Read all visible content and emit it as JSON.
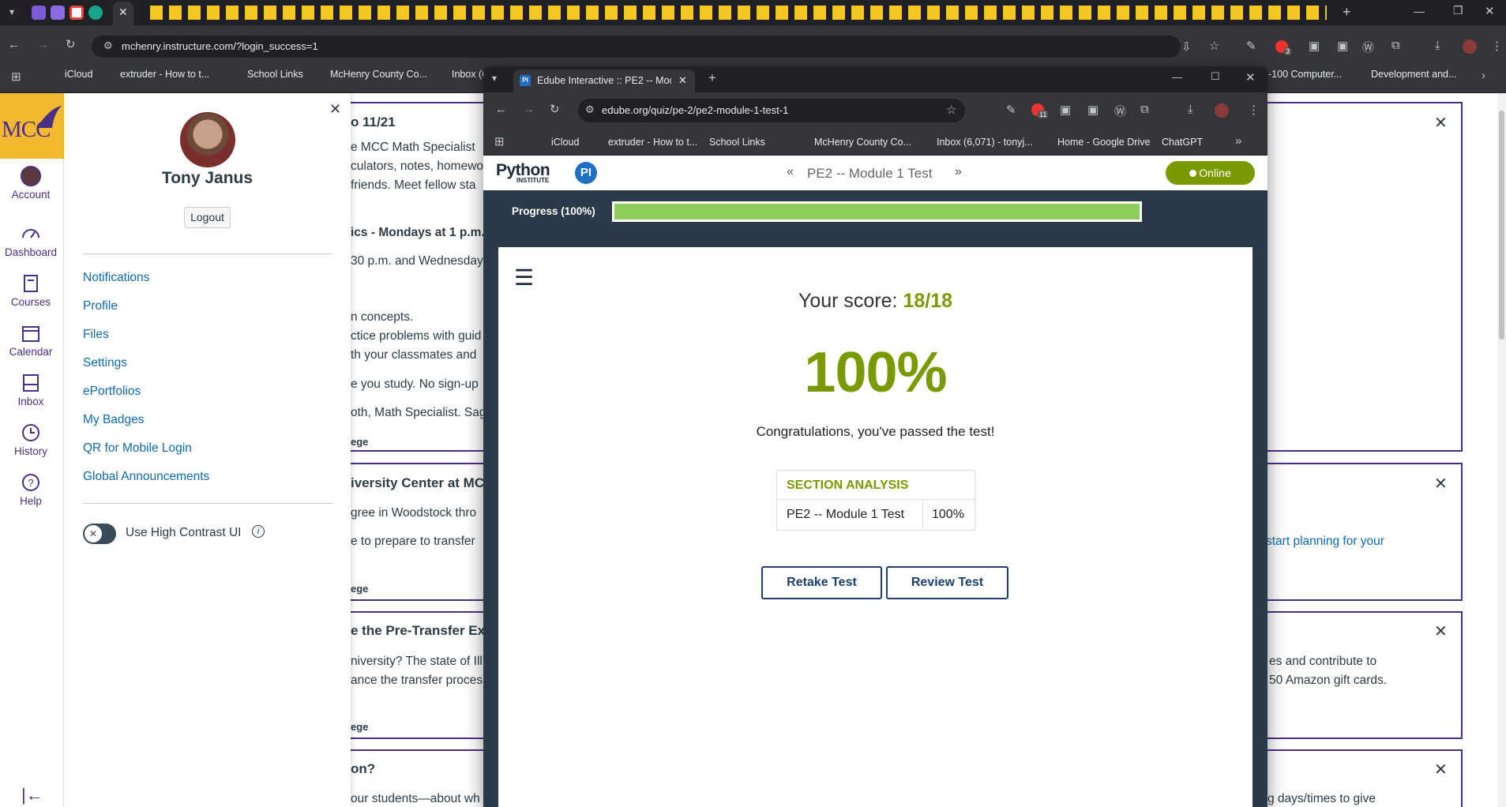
{
  "outer_browser": {
    "url": "mchenry.instructure.com/?login_success=1",
    "bookmarks": [
      "iCloud",
      "extruder - How to t...",
      "School Links",
      "McHenry County Co...",
      "Inbox (6,071) - tonyj...",
      "-100 Computer...",
      "Development and..."
    ],
    "extension_badge": "3"
  },
  "canvas": {
    "global_nav": {
      "logo": "MCC",
      "items": [
        "Account",
        "Dashboard",
        "Courses",
        "Calendar",
        "Inbox",
        "History",
        "Help"
      ]
    },
    "account_tray": {
      "user_name": "Tony Janus",
      "logout_label": "Logout",
      "links": [
        "Notifications",
        "Profile",
        "Files",
        "Settings",
        "ePortfolios",
        "My Badges",
        "QR for Mobile Login",
        "Global Announcements"
      ],
      "high_contrast_label": "Use High Contrast UI"
    },
    "background_fragments": {
      "card1": [
        "o 11/21",
        "e MCC Math Specialist",
        "culators, notes, homewo",
        "friends. Meet fellow sta",
        "ics - Mondays at 1 p.m.",
        "30 p.m. and Wednesday",
        "n concepts.",
        "ctice problems with guid",
        "th your classmates and",
        "e you study. No sign-up",
        "oth, Math Specialist. Sag",
        "ege"
      ],
      "card2": [
        "iversity Center at MC",
        "gree in Woodstock thro",
        "e to prepare to transfer",
        "ege",
        "start planning for your"
      ],
      "card3": [
        "e the Pre-Transfer Exp",
        "niversity? The state of Ill",
        "ance the transfer proces",
        "ege",
        "es and contribute to",
        "50 Amazon gift cards."
      ],
      "card4": [
        "on?",
        "our students—about wh",
        "g days/times to give"
      ]
    }
  },
  "inner_browser": {
    "tab_title": "Edube Interactive :: PE2 -- Modu",
    "url": "edube.org/quiz/pe-2/pe2-module-1-test-1",
    "bookmarks": [
      "iCloud",
      "extruder - How to t...",
      "School Links",
      "McHenry County Co...",
      "Inbox (6,071) - tonyj...",
      "Home - Google Drive",
      "ChatGPT"
    ],
    "extension_badge": "11"
  },
  "edube": {
    "logo_text": "Python",
    "logo_sub": "INSTITUTE",
    "logo_badge": "PI",
    "quiz_title": "PE2 -- Module 1 Test",
    "status": "Online",
    "progress_label": "Progress (100%)",
    "progress_fraction": 1.0,
    "score_label": "Your score:",
    "score_value": "18/18",
    "percent": "100%",
    "congrats": "Congratulations, you've passed the test!",
    "section_analysis": {
      "header": "SECTION ANALYSIS",
      "rows": [
        {
          "name": "PE2 -- Module 1 Test",
          "value": "100%"
        }
      ]
    },
    "retake_label": "Retake Test",
    "review_label": "Review Test",
    "colors": {
      "score_green": "#7a9a01",
      "progress_green": "#8ccd5b",
      "navy": "#1d3f6e",
      "canvas_purple": "#4a2e87",
      "mcc_gold": "#f4b830"
    }
  }
}
